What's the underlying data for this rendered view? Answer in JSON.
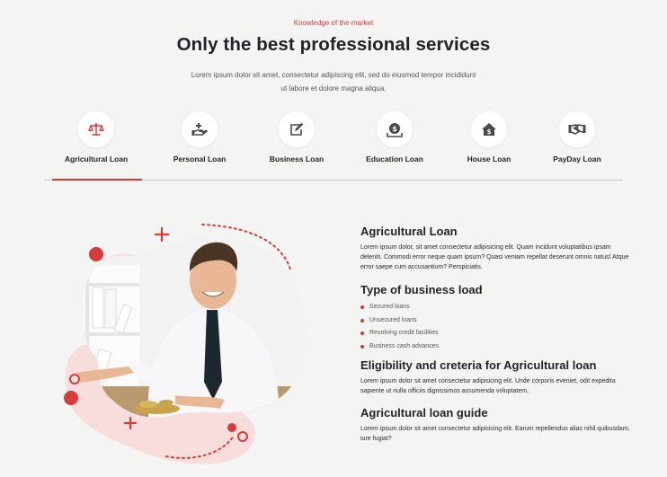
{
  "header": {
    "eyebrow": "Knowledge of the market",
    "title": "Only the best professional services",
    "intro": "Lorem ipsum dolor sit amet, consectetur adipiscing elit, sed do eiusmod tempor incididunt ut labore et dolore magna aliqua."
  },
  "tabs": [
    {
      "label": "Agricultural Loan",
      "icon": "scales-icon",
      "active": true
    },
    {
      "label": "Personal Loan",
      "icon": "hand-plus-icon",
      "active": false
    },
    {
      "label": "Business Loan",
      "icon": "edit-note-icon",
      "active": false
    },
    {
      "label": "Education Loan",
      "icon": "money-bag-icon",
      "active": false
    },
    {
      "label": "House Loan",
      "icon": "house-dollar-icon",
      "active": false
    },
    {
      "label": "PayDay Loan",
      "icon": "handshake-icon",
      "active": false
    }
  ],
  "colors": {
    "accent": "#d93a3a",
    "icon": "#4a4a4a",
    "heading": "#1f2228"
  },
  "details": {
    "s1": {
      "title": "Agricultural Loan",
      "text": "Lorem ipsum dolor, sit amet consectetur adipisicing elit. Quam incidunt voluptatibus ipsam deleniti. Commodi error neque quam ipsum? Quasi veniam repellat deserunt omnis natus! Atque error saepe cum accusantium? Perspiciatis."
    },
    "s2": {
      "title": "Type of business load",
      "items": [
        "Secured loans",
        "Unsecured loans",
        "Revolving credit facilities",
        "Business cash advances"
      ]
    },
    "s3": {
      "title": "Eligibility and creteria for Agricultural loan",
      "text": "Lorem ipsum dolor sit amet consectetur adipisicing elit. Unde corporis eveniet, odit expedita sapiente ut nulla officiis dignissimos assumenda voluptatem."
    },
    "s4": {
      "title": "Agricultural loan guide",
      "text": "Lorem ipsum dolor sit amet consectetur adipisicing elit. Earum repellendus alias nihil quibusdam, iure fugiat?"
    }
  }
}
